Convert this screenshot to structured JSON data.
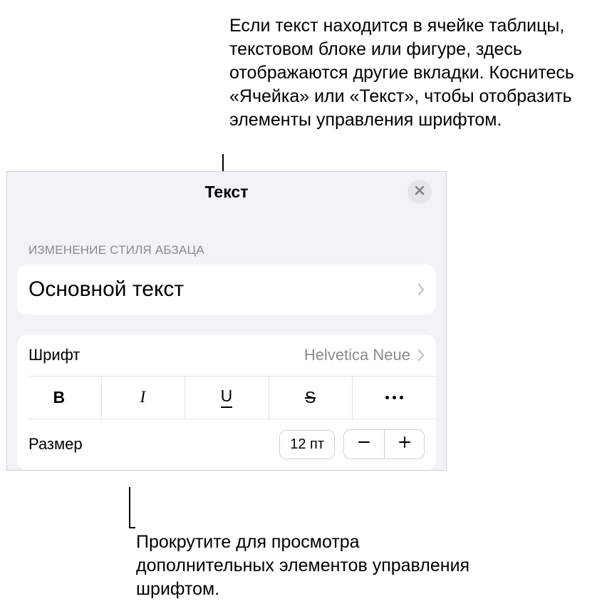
{
  "callouts": {
    "top": "Если текст находится в ячейке таблицы, текстовом блоке или фигуре, здесь отображаются другие вкладки. Коснитесь «Ячейка» или «Текст», чтобы отобразить элементы управления шрифтом.",
    "bottom": "Прокрутите для просмотра дополнительных элементов управления шрифтом."
  },
  "panel": {
    "title": "Текст",
    "section_header": "ИЗМЕНЕНИЕ СТИЛЯ АБЗАЦА",
    "style_name": "Основной текст",
    "font": {
      "label": "Шрифт",
      "value": "Helvetica Neue"
    },
    "format_buttons": {
      "bold": "B",
      "italic": "I",
      "underline": "U",
      "strike": "S"
    },
    "size": {
      "label": "Размер",
      "value": "12 пт"
    }
  }
}
